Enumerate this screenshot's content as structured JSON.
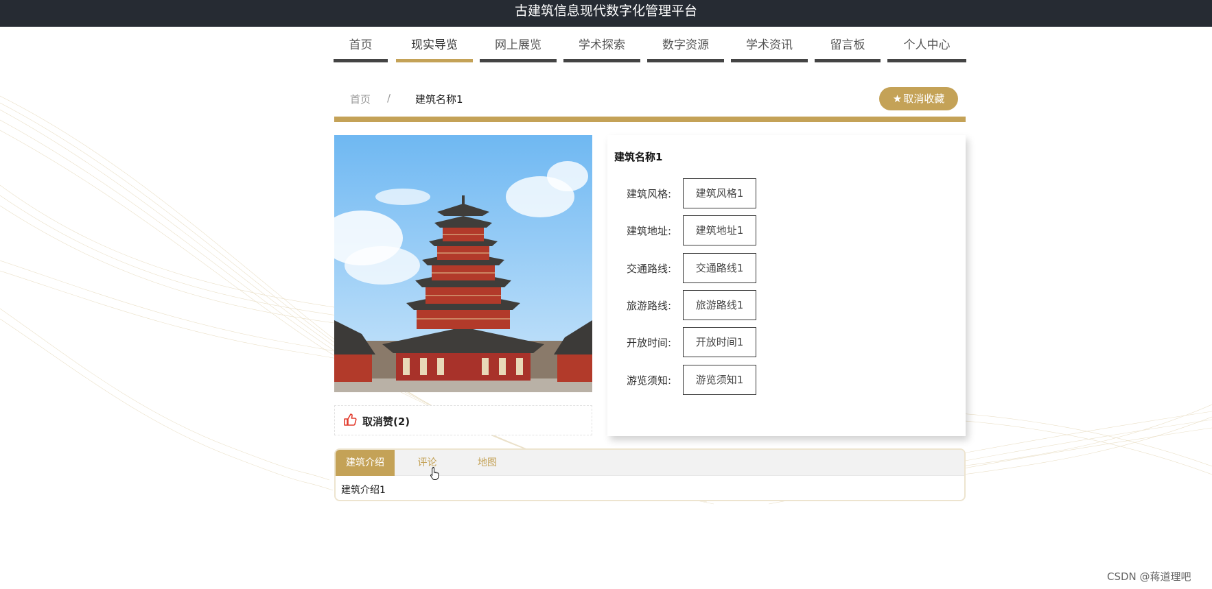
{
  "header": {
    "title": "古建筑信息现代数字化管理平台"
  },
  "nav": [
    {
      "label": "首页"
    },
    {
      "label": "现实导览"
    },
    {
      "label": "网上展览"
    },
    {
      "label": "学术探索"
    },
    {
      "label": "数字资源"
    },
    {
      "label": "学术资讯"
    },
    {
      "label": "留言板"
    },
    {
      "label": "个人中心"
    }
  ],
  "nav_active_index": 1,
  "breadcrumb": {
    "home": "首页",
    "separator": "/",
    "current": "建筑名称1"
  },
  "actions": {
    "unfavorite": "取消收藏",
    "unfavorite_icon": "star-icon"
  },
  "like": {
    "label": "取消赞(2)",
    "icon": "thumbs-up-icon"
  },
  "info": {
    "name": "建筑名称1",
    "fields": [
      {
        "label": "建筑风格:",
        "value": "建筑风格1"
      },
      {
        "label": "建筑地址:",
        "value": "建筑地址1"
      },
      {
        "label": "交通路线:",
        "value": "交通路线1"
      },
      {
        "label": "旅游路线:",
        "value": "旅游路线1"
      },
      {
        "label": "开放时间:",
        "value": "开放时间1"
      },
      {
        "label": "游览须知:",
        "value": "游览须知1"
      }
    ]
  },
  "tabs": [
    {
      "label": "建筑介绍"
    },
    {
      "label": "评论"
    },
    {
      "label": "地图"
    }
  ],
  "tab_content": "建筑介绍1",
  "watermark": "CSDN @蒋道理吧",
  "colors": {
    "accent": "#c4a257",
    "topbar": "#262b33",
    "nav_underline": "#444444",
    "like_icon": "#e23a2c"
  }
}
